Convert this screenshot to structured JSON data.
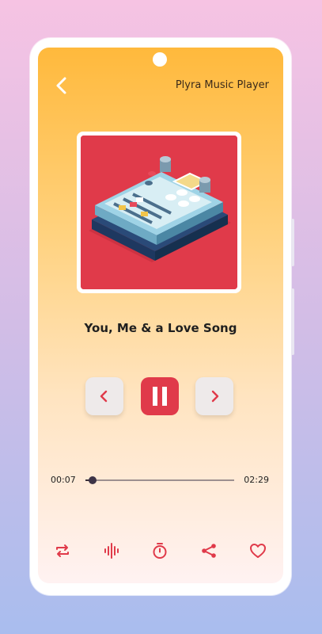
{
  "app": {
    "title": "Plyra Music Player",
    "accent_color": "#e03a4a",
    "gradient_top": "#ffb93c",
    "gradient_bottom": "#fff2f2"
  },
  "header": {
    "back_icon": "chevron-left-icon"
  },
  "now_playing": {
    "artwork_icon": "mixer-console-illustration",
    "song_title": "You, Me & a Love Song"
  },
  "controls": {
    "previous_icon": "chevron-left-icon",
    "play_pause_icon": "pause-icon",
    "next_icon": "chevron-right-icon",
    "state": "playing"
  },
  "progress": {
    "elapsed": "00:07",
    "duration": "02:29",
    "fraction": 0.047
  },
  "bottom_actions": [
    {
      "name": "repeat",
      "icon": "repeat-icon"
    },
    {
      "name": "equalizer",
      "icon": "sound-wave-icon"
    },
    {
      "name": "sleep-timer",
      "icon": "stopwatch-icon"
    },
    {
      "name": "share",
      "icon": "share-icon"
    },
    {
      "name": "favorite",
      "icon": "heart-icon"
    }
  ]
}
